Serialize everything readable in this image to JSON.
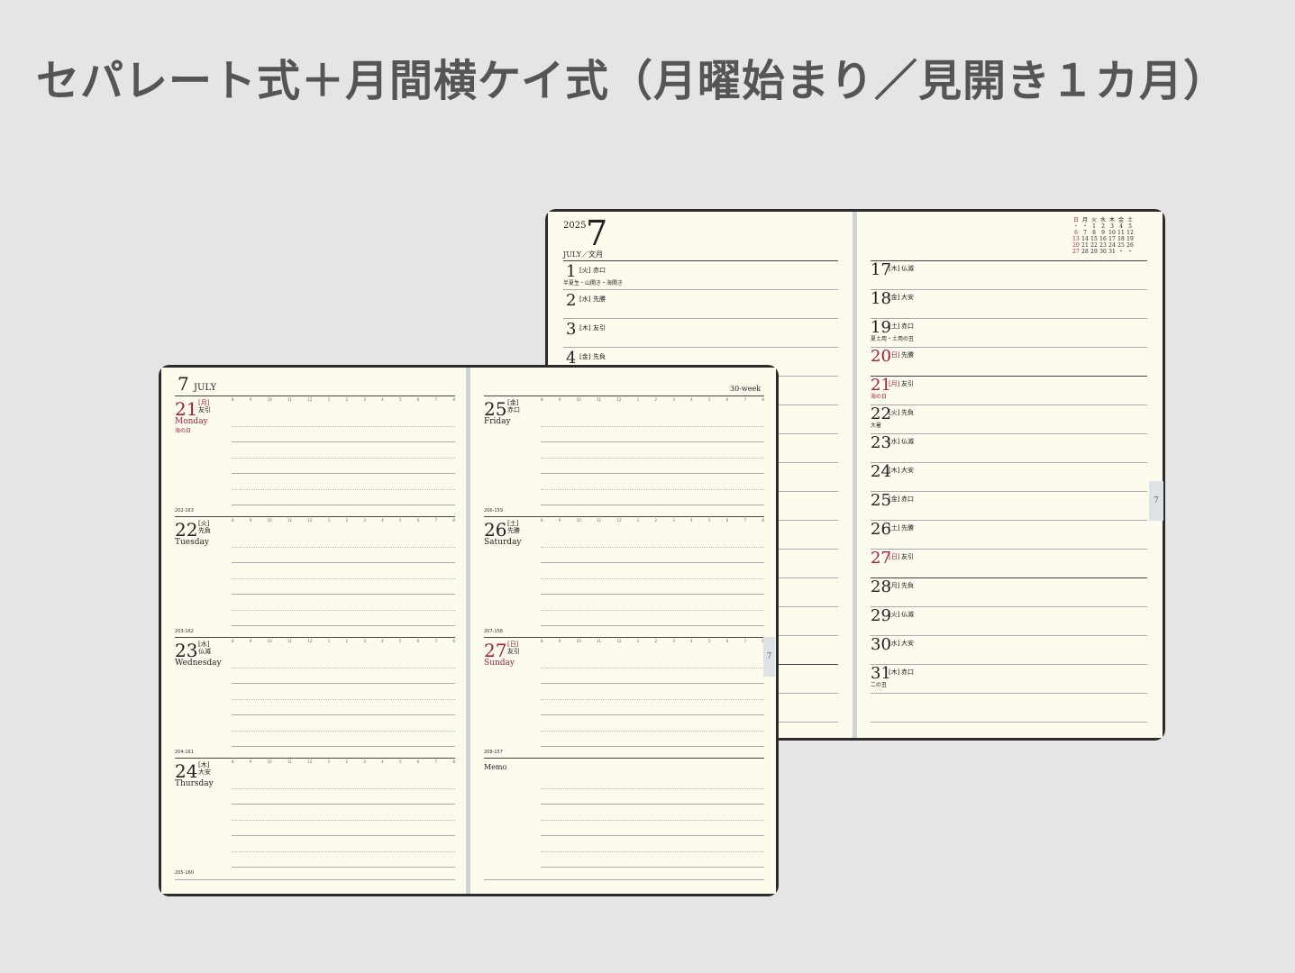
{
  "page_title": "セパレート式＋月間横ケイ式（月曜始まり／見開き１カ月）",
  "monthly": {
    "year": "2025",
    "month": "7",
    "month_label": "JULY／文月",
    "side_tab": "7",
    "left_days": [
      {
        "day": "1",
        "wd": "[火]",
        "rokuyo": "赤口",
        "note": "半夏生・山開き・海開き"
      },
      {
        "day": "2",
        "wd": "[水]",
        "rokuyo": "先勝",
        "note": ""
      },
      {
        "day": "3",
        "wd": "[木]",
        "rokuyo": "友引",
        "note": ""
      },
      {
        "day": "4",
        "wd": "[金]",
        "rokuyo": "先負",
        "note": ""
      }
    ],
    "right_days": [
      {
        "day": "17",
        "wd": "[木]",
        "rokuyo": "仏滅",
        "note": "",
        "red": false
      },
      {
        "day": "18",
        "wd": "[金]",
        "rokuyo": "大安",
        "note": "",
        "red": false
      },
      {
        "day": "19",
        "wd": "[土]",
        "rokuyo": "赤口",
        "note": "夏土用・土用の丑",
        "red": false
      },
      {
        "day": "20",
        "wd": "[日]",
        "rokuyo": "先勝",
        "note": "",
        "red": true
      },
      {
        "day": "21",
        "wd": "[月]",
        "rokuyo": "友引",
        "note": "海の日",
        "red": true
      },
      {
        "day": "22",
        "wd": "[火]",
        "rokuyo": "先負",
        "note": "大暑",
        "red": false
      },
      {
        "day": "23",
        "wd": "[水]",
        "rokuyo": "仏滅",
        "note": "",
        "red": false
      },
      {
        "day": "24",
        "wd": "[木]",
        "rokuyo": "大安",
        "note": "",
        "red": false
      },
      {
        "day": "25",
        "wd": "[金]",
        "rokuyo": "赤口",
        "note": "",
        "red": false
      },
      {
        "day": "26",
        "wd": "[土]",
        "rokuyo": "先勝",
        "note": "",
        "red": false
      },
      {
        "day": "27",
        "wd": "[日]",
        "rokuyo": "友引",
        "note": "",
        "red": true
      },
      {
        "day": "28",
        "wd": "[月]",
        "rokuyo": "先負",
        "note": "",
        "red": false
      },
      {
        "day": "29",
        "wd": "[火]",
        "rokuyo": "仏滅",
        "note": "",
        "red": false
      },
      {
        "day": "30",
        "wd": "[水]",
        "rokuyo": "大安",
        "note": "",
        "red": false
      },
      {
        "day": "31",
        "wd": "[木]",
        "rokuyo": "赤口",
        "note": "二の丑",
        "red": false
      }
    ],
    "mini_calendar": {
      "header": [
        "日",
        "月",
        "火",
        "水",
        "木",
        "金",
        "土"
      ],
      "rows": [
        [
          "・",
          "・",
          "1",
          "2",
          "3",
          "4",
          "5"
        ],
        [
          "6",
          "7",
          "8",
          "9",
          "10",
          "11",
          "12"
        ],
        [
          "13",
          "14",
          "15",
          "16",
          "17",
          "18",
          "19"
        ],
        [
          "20",
          "21",
          "22",
          "23",
          "24",
          "25",
          "26"
        ],
        [
          "27",
          "28",
          "29",
          "30",
          "31",
          "・",
          "・"
        ]
      ]
    }
  },
  "weekly": {
    "month_num": "7",
    "month_name": "JULY",
    "week_label": "30-week",
    "side_tab": "7",
    "hours": [
      "8",
      "9",
      "10",
      "11",
      "12",
      "1",
      "2",
      "3",
      "4",
      "5",
      "6",
      "7",
      "8"
    ],
    "memo_label": "Memo",
    "left_days": [
      {
        "day": "21",
        "wd": "[月]",
        "rokuyo": "友引",
        "name": "Monday",
        "holiday": "海の日",
        "code": "202-163",
        "red": true
      },
      {
        "day": "22",
        "wd": "[火]",
        "rokuyo": "先負",
        "name": "Tuesday",
        "holiday": "",
        "code": "203-162",
        "red": false
      },
      {
        "day": "23",
        "wd": "[水]",
        "rokuyo": "仏滅",
        "name": "Wednesday",
        "holiday": "",
        "code": "204-161",
        "red": false
      },
      {
        "day": "24",
        "wd": "[木]",
        "rokuyo": "大安",
        "name": "Thursday",
        "holiday": "",
        "code": "205-160",
        "red": false
      }
    ],
    "right_days": [
      {
        "day": "25",
        "wd": "[金]",
        "rokuyo": "赤口",
        "name": "Friday",
        "code": "206-159",
        "red": false
      },
      {
        "day": "26",
        "wd": "[土]",
        "rokuyo": "先勝",
        "name": "Saturday",
        "code": "207-158",
        "red": false
      },
      {
        "day": "27",
        "wd": "[日]",
        "rokuyo": "友引",
        "name": "Sunday",
        "code": "208-157",
        "red": true
      }
    ]
  }
}
